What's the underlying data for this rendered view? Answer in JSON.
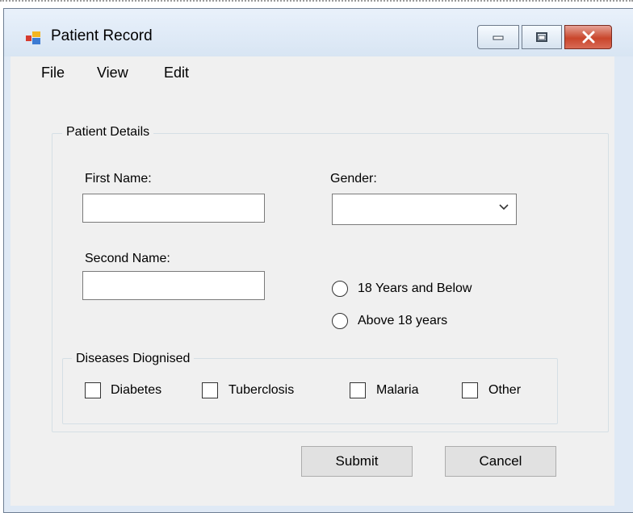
{
  "window": {
    "title": "Patient Record"
  },
  "menu": {
    "items": [
      "File",
      "View",
      "Edit"
    ]
  },
  "patient_details": {
    "group_label": "Patient Details",
    "first_name": {
      "label": "First Name:",
      "value": ""
    },
    "second_name": {
      "label": "Second Name:",
      "value": ""
    },
    "gender": {
      "label": "Gender:",
      "selected": ""
    },
    "age_options": [
      {
        "label": "18 Years and Below",
        "checked": false
      },
      {
        "label": "Above 18 years",
        "checked": false
      }
    ]
  },
  "diseases": {
    "group_label": "Diseases Diognised",
    "options": [
      {
        "label": "Diabetes",
        "checked": false
      },
      {
        "label": "Tuberclosis",
        "checked": false
      },
      {
        "label": "Malaria",
        "checked": false
      },
      {
        "label": "Other",
        "checked": false
      }
    ]
  },
  "actions": {
    "submit": "Submit",
    "cancel": "Cancel"
  },
  "icons": {
    "app": "app-window-icon",
    "minimize": "minimize-icon",
    "maximize": "maximize-icon",
    "close": "close-icon",
    "dropdown": "chevron-down-icon"
  },
  "colors": {
    "close_button": "#c9462c",
    "title_bar": "#dfe9f5",
    "client": "#f0f0f0"
  }
}
